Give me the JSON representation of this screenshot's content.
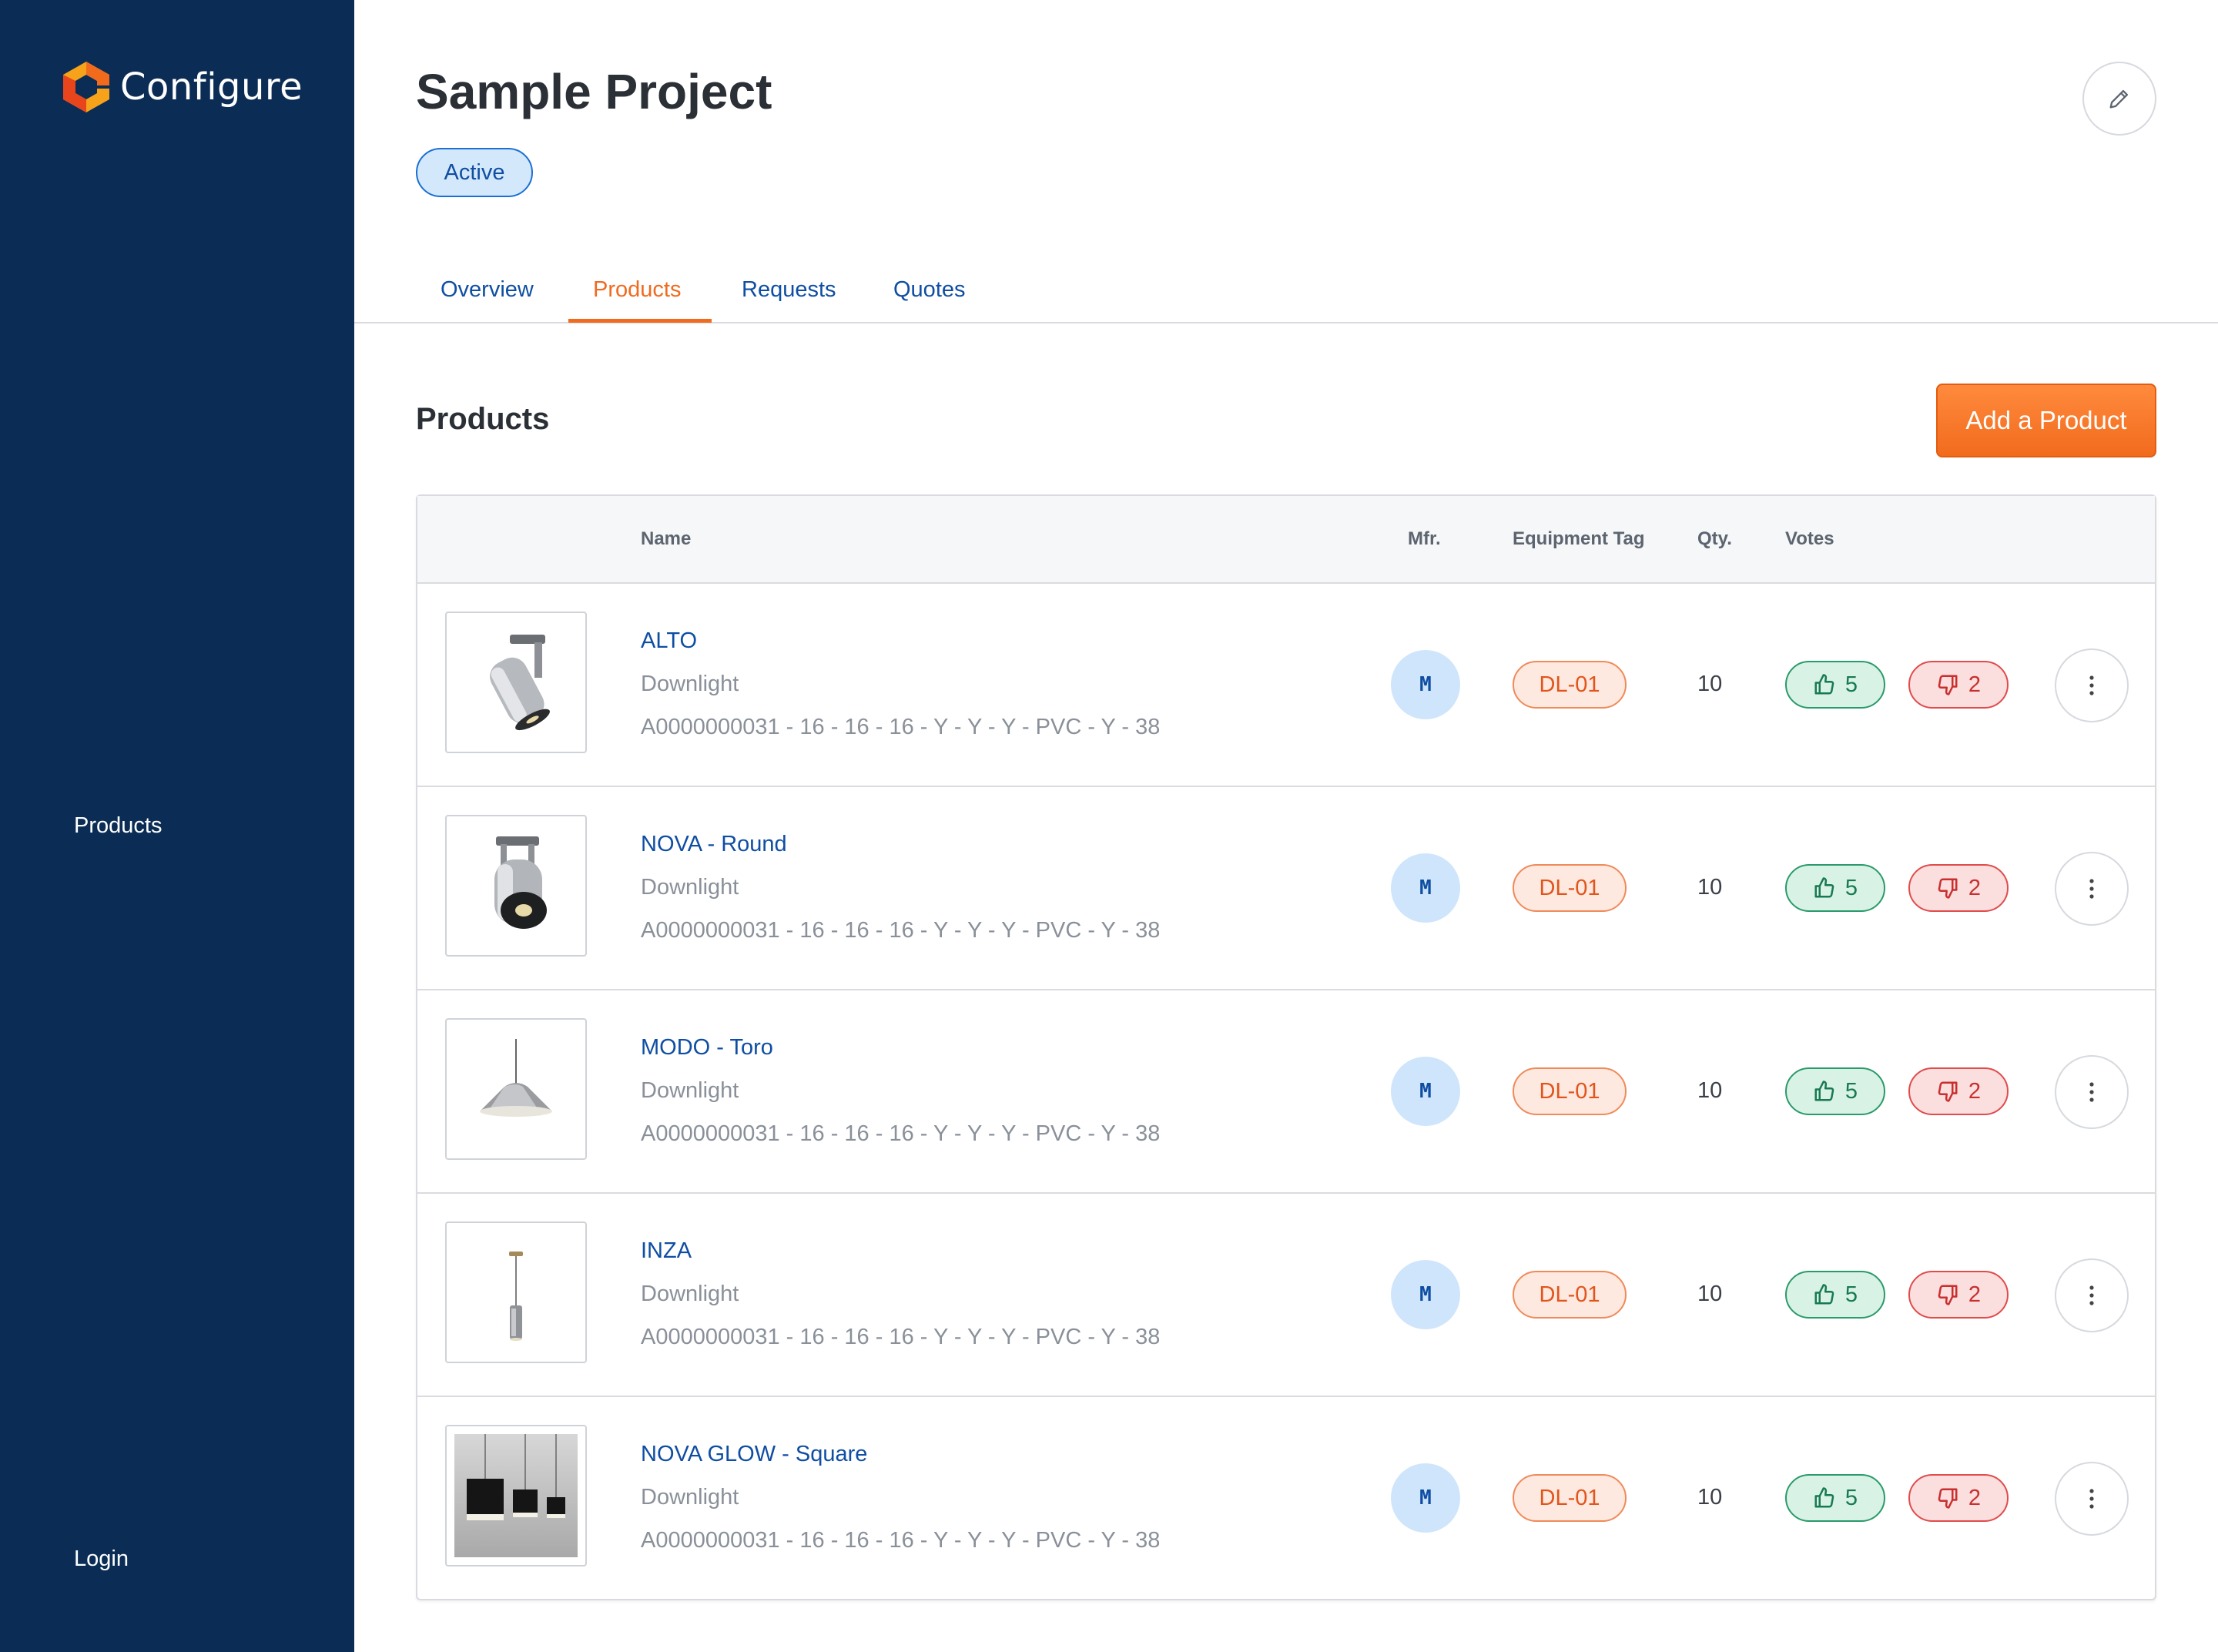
{
  "app": {
    "name": "Configure"
  },
  "sidebar": {
    "products_label": "Products",
    "login_label": "Login"
  },
  "header": {
    "title": "Sample Project",
    "status": "Active"
  },
  "tabs": [
    {
      "label": "Overview",
      "active": false
    },
    {
      "label": "Products",
      "active": true
    },
    {
      "label": "Requests",
      "active": false
    },
    {
      "label": "Quotes",
      "active": false
    }
  ],
  "section": {
    "title": "Products",
    "add_button_label": "Add a Product"
  },
  "table": {
    "columns": {
      "name": "Name",
      "mfr": "Mfr.",
      "tag": "Equipment Tag",
      "qty": "Qty.",
      "votes": "Votes"
    },
    "rows": [
      {
        "name": "ALTO",
        "type": "Downlight",
        "code": "A0000000031 - 16 - 16 - 16 - Y - Y - Y - PVC - Y - 38",
        "mfr": "M",
        "tag": "DL-01",
        "qty": "10",
        "up": "5",
        "down": "2",
        "image": "track-spotlight"
      },
      {
        "name": "NOVA - Round",
        "type": "Downlight",
        "code": "A0000000031 - 16 - 16 - 16 - Y - Y - Y - PVC - Y - 38",
        "mfr": "M",
        "tag": "DL-01",
        "qty": "10",
        "up": "5",
        "down": "2",
        "image": "round-spotlight"
      },
      {
        "name": "MODO - Toro",
        "type": "Downlight",
        "code": "A0000000031 - 16 - 16 - 16 - Y - Y - Y - PVC - Y - 38",
        "mfr": "M",
        "tag": "DL-01",
        "qty": "10",
        "up": "5",
        "down": "2",
        "image": "dome-pendant"
      },
      {
        "name": "INZA",
        "type": "Downlight",
        "code": "A0000000031 - 16 - 16 - 16 - Y - Y - Y - PVC - Y - 38",
        "mfr": "M",
        "tag": "DL-01",
        "qty": "10",
        "up": "5",
        "down": "2",
        "image": "cylinder-pendant"
      },
      {
        "name": "NOVA GLOW - Square",
        "type": "Downlight",
        "code": "A0000000031 - 16 - 16 - 16 - Y - Y - Y - PVC - Y - 38",
        "mfr": "M",
        "tag": "DL-01",
        "qty": "10",
        "up": "5",
        "down": "2",
        "image": "square-pendants-photo"
      }
    ]
  },
  "colors": {
    "sidebar": "#0b2d55",
    "accent": "#f06a1f",
    "link": "#0f4ea3",
    "vote_up": "#187a51",
    "vote_down": "#c92f2f"
  }
}
